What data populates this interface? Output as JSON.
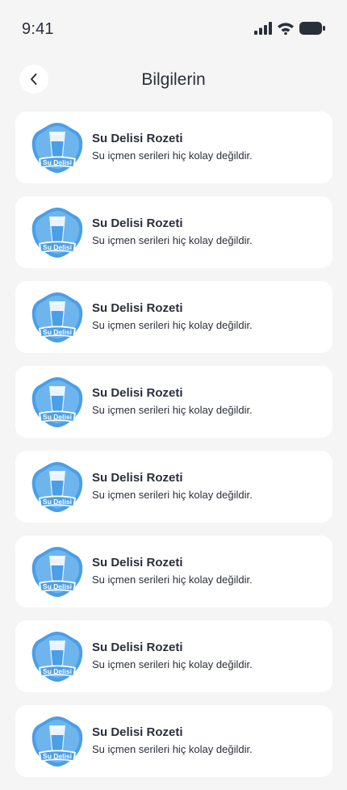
{
  "status_bar": {
    "time": "9:41"
  },
  "header": {
    "title": "Bilgilerin"
  },
  "badges": [
    {
      "title": "Su Delisi Rozeti",
      "description": "Su içmen serileri hiç kolay değildir.",
      "badge_label": "Su Delisi"
    },
    {
      "title": "Su Delisi Rozeti",
      "description": "Su içmen serileri hiç kolay değildir.",
      "badge_label": "Su Delisi"
    },
    {
      "title": "Su Delisi Rozeti",
      "description": "Su içmen serileri hiç kolay değildir.",
      "badge_label": "Su Delisi"
    },
    {
      "title": "Su Delisi Rozeti",
      "description": "Su içmen serileri hiç kolay değildir.",
      "badge_label": "Su Delisi"
    },
    {
      "title": "Su Delisi Rozeti",
      "description": "Su içmen serileri hiç kolay değildir.",
      "badge_label": "Su Delisi"
    },
    {
      "title": "Su Delisi Rozeti",
      "description": "Su içmen serileri hiç kolay değildir.",
      "badge_label": "Su Delisi"
    },
    {
      "title": "Su Delisi Rozeti",
      "description": "Su içmen serileri hiç kolay değildir.",
      "badge_label": "Su Delisi"
    },
    {
      "title": "Su Delisi Rozeti",
      "description": "Su içmen serileri hiç kolay değildir.",
      "badge_label": "Su Delisi"
    }
  ],
  "colors": {
    "background": "#f5f5f6",
    "card": "#ffffff",
    "badge_blue": "#4a9fe6",
    "badge_light": "#8cc6f2",
    "text": "#2b2f3a"
  }
}
